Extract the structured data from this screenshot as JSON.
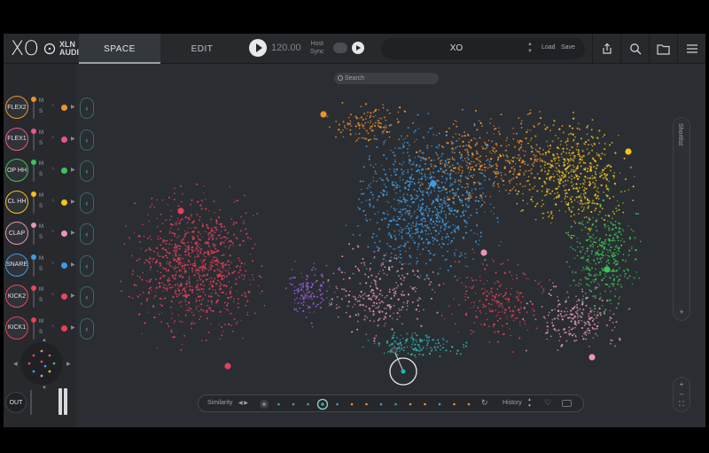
{
  "app": {
    "logo_text": "XO",
    "brand_line1": "XLN",
    "brand_line2": "AUDIO"
  },
  "tabs": [
    {
      "label": "SPACE",
      "active": true
    },
    {
      "label": "EDIT",
      "active": false
    }
  ],
  "transport": {
    "bpm": "120.00",
    "host_sync_line1": "Host",
    "host_sync_line2": "Sync"
  },
  "preset": {
    "name": "XO",
    "load_label": "Load",
    "save_label": "Save"
  },
  "top_icons": [
    "export-icon",
    "search-icon",
    "folder-icon",
    "menu-icon"
  ],
  "tracks": [
    {
      "name": "FLEX2",
      "color": "#f0922b"
    },
    {
      "name": "FLEX1",
      "color": "#e9558f"
    },
    {
      "name": "OP HH",
      "color": "#3cc45a"
    },
    {
      "name": "CL HH",
      "color": "#f2c31b"
    },
    {
      "name": "CLAP",
      "color": "#e896b8"
    },
    {
      "name": "SNARE",
      "color": "#3f9be3"
    },
    {
      "name": "KICK2",
      "color": "#e8475f"
    },
    {
      "name": "KICK1",
      "color": "#ea3f55"
    }
  ],
  "track_buttons": {
    "mute": "M",
    "solo": "S"
  },
  "output": {
    "label": "OUT"
  },
  "search": {
    "placeholder": "Search"
  },
  "shortlist": {
    "label": "Shortlist"
  },
  "bottom": {
    "similarity_label": "Similarity",
    "history_label": "History"
  },
  "colors": {
    "kick": "#e2415a",
    "snare": "#3f9be3",
    "flex2": "#f0922b",
    "clhh": "#f2c31b",
    "ophh": "#3cc45a",
    "clap": "#e896b8",
    "purple": "#9a5fd6",
    "teal": "#2bb5b0"
  }
}
